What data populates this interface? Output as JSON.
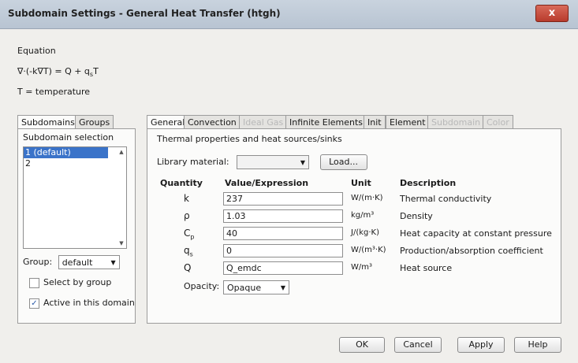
{
  "window": {
    "title": "Subdomain Settings - General Heat Transfer (htgh)",
    "close": "x"
  },
  "equation": {
    "label": "Equation",
    "formula": "∇·(-k∇T) = Q + q",
    "formula_sub": "s",
    "formula_tail": "T",
    "definition": "T = temperature"
  },
  "left": {
    "tabs": [
      "Subdomains",
      "Groups"
    ],
    "selection_label": "Subdomain selection",
    "items": [
      "1 (default)",
      "2"
    ],
    "group_label": "Group:",
    "group_value": "default",
    "select_by_group": "Select by group",
    "active_in_domain": "Active in this domain"
  },
  "right": {
    "tabs": [
      "General",
      "Convection",
      "Ideal Gas",
      "Infinite Elements",
      "Init",
      "Element",
      "Subdomain",
      "Color"
    ],
    "thermal_label": "Thermal properties and heat sources/sinks",
    "library_label": "Library material:",
    "load_button": "Load...",
    "headers": {
      "quantity": "Quantity",
      "value": "Value/Expression",
      "unit": "Unit",
      "description": "Description"
    },
    "rows": [
      {
        "symbol": "k",
        "sub": "",
        "value": "237",
        "unit": "W/(m·K)",
        "description": "Thermal conductivity"
      },
      {
        "symbol": "ρ",
        "sub": "",
        "value": "1.03",
        "unit": "kg/m³",
        "description": "Density"
      },
      {
        "symbol": "C",
        "sub": "p",
        "value": "40",
        "unit": "J/(kg·K)",
        "description": "Heat capacity at constant pressure"
      },
      {
        "symbol": "q",
        "sub": "s",
        "value": "0",
        "unit": "W/(m³·K)",
        "description": "Production/absorption coefficient"
      },
      {
        "symbol": "Q",
        "sub": "",
        "value": "Q_emdc",
        "unit": "W/m³",
        "description": "Heat source"
      }
    ],
    "opacity_label": "Opacity:",
    "opacity_value": "Opaque"
  },
  "buttons": {
    "ok": "OK",
    "cancel": "Cancel",
    "apply": "Apply",
    "help": "Help"
  }
}
